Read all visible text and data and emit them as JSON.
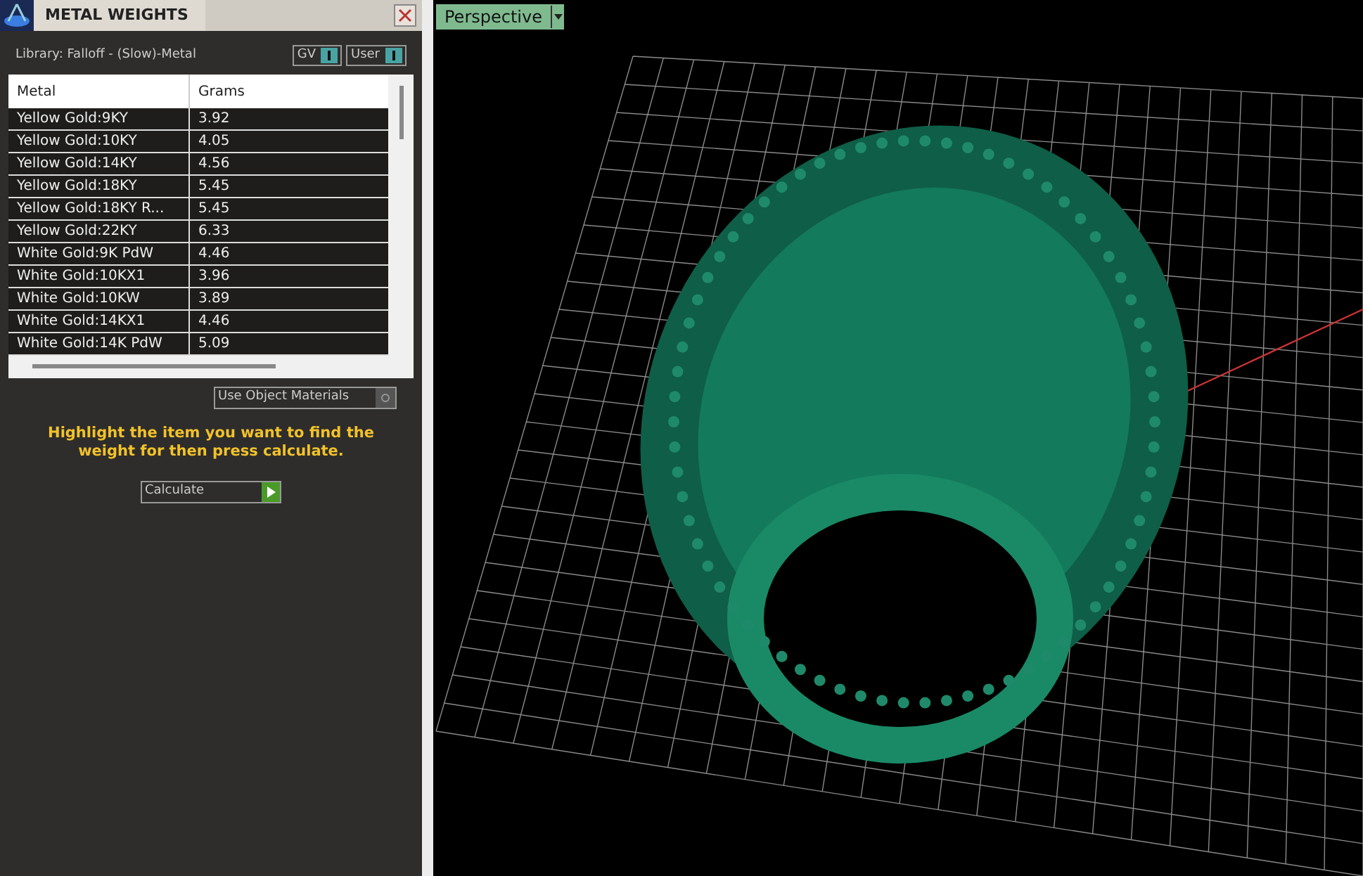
{
  "panel": {
    "title": "METAL WEIGHTS",
    "library": "Library: Falloff - (Slow)-Metal",
    "toggles": [
      {
        "label": "GV",
        "on": true
      },
      {
        "label": "User",
        "on": true
      }
    ]
  },
  "table": {
    "columns": [
      "Metal",
      "Grams"
    ],
    "rows": [
      {
        "metal": "Yellow Gold:9KY",
        "grams": "3.92"
      },
      {
        "metal": "Yellow Gold:10KY",
        "grams": "4.05"
      },
      {
        "metal": "Yellow Gold:14KY",
        "grams": "4.56"
      },
      {
        "metal": "Yellow Gold:18KY",
        "grams": "5.45"
      },
      {
        "metal": "Yellow Gold:18KY R...",
        "grams": "5.45"
      },
      {
        "metal": "Yellow Gold:22KY",
        "grams": "6.33"
      },
      {
        "metal": "White Gold:9K PdW",
        "grams": "4.46"
      },
      {
        "metal": "White Gold:10KX1",
        "grams": "3.96"
      },
      {
        "metal": "White Gold:10KW",
        "grams": "3.89"
      },
      {
        "metal": "White Gold:14KX1",
        "grams": "4.46"
      },
      {
        "metal": "White Gold:14K PdW",
        "grams": "5.09"
      }
    ]
  },
  "use_object_materials": {
    "label": "Use Object Materials",
    "on": false
  },
  "hint": "Highlight the item you want to find the weight for then press calculate.",
  "calculate_button": "Calculate",
  "viewport": {
    "view_label": "Perspective"
  }
}
